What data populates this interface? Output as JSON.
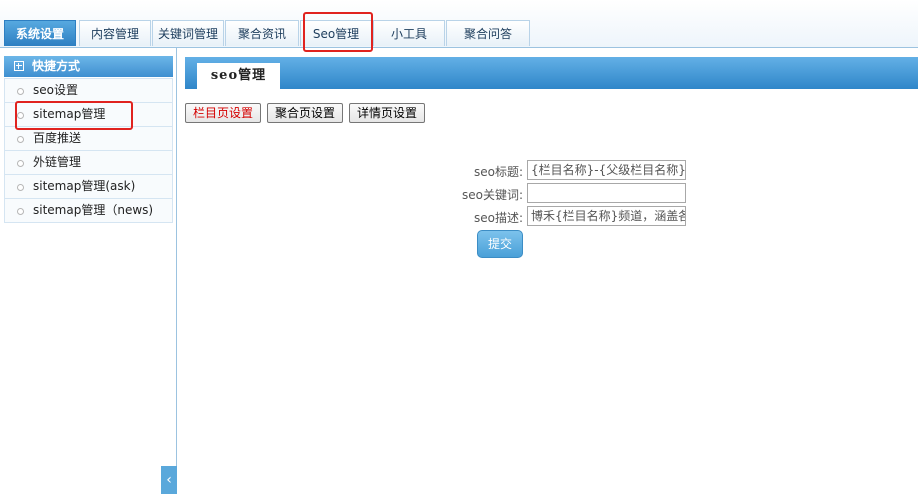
{
  "top_tabs": [
    "系统设置",
    "内容管理",
    "关键词管理",
    "聚合资讯",
    "Seo管理",
    "小工具",
    "聚合问答"
  ],
  "sidebar": {
    "title": "快捷方式",
    "items": [
      "seo设置",
      "sitemap管理",
      "百度推送",
      "外链管理",
      "sitemap管理(ask)",
      "sitemap管理（news)"
    ]
  },
  "main": {
    "tab_title": "seo管理",
    "buttons": [
      "栏目页设置",
      "聚合页设置",
      "详情页设置"
    ],
    "form": {
      "title_label": "seo标题:",
      "title_value": "{栏目名称}-{父级栏目名称}",
      "keywords_label": "seo关键词:",
      "keywords_value": "",
      "desc_label": "seo描述:",
      "desc_value": "博禾{栏目名称}频道，涵盖各",
      "submit": "提交"
    }
  },
  "collapse_icon": "‹",
  "colors": {
    "accent": "#2d7fc2",
    "highlight": "#e0231f",
    "button_red_text": "#d40000"
  }
}
